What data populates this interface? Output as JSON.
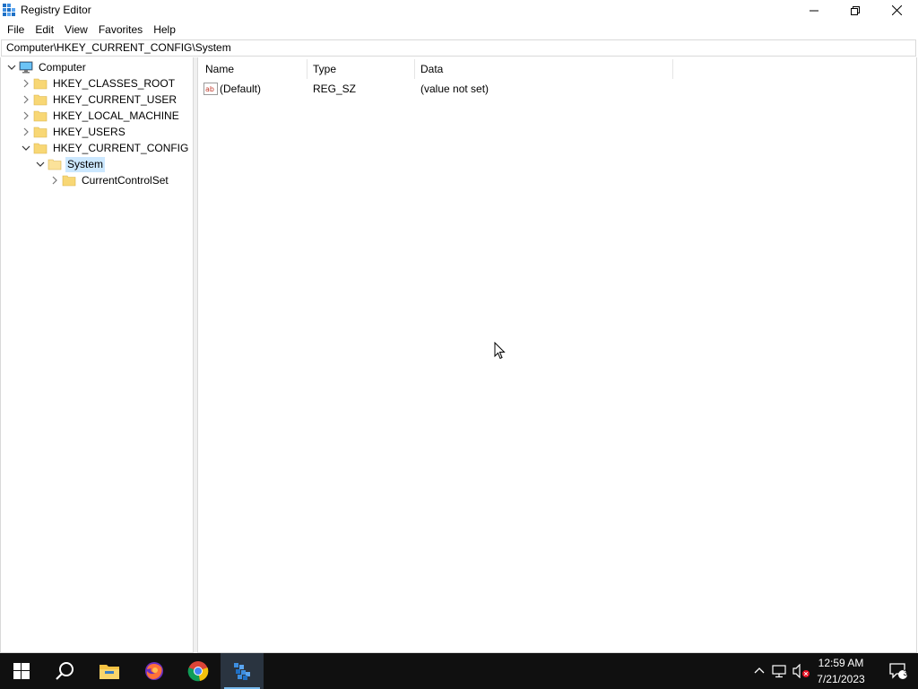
{
  "window": {
    "title": "Registry Editor",
    "icon": "registry-editor-icon",
    "controls": [
      "minimize-icon",
      "restore-icon",
      "close-icon"
    ]
  },
  "menu": {
    "items": [
      "File",
      "Edit",
      "View",
      "Favorites",
      "Help"
    ]
  },
  "address": {
    "value": "Computer\\HKEY_CURRENT_CONFIG\\System"
  },
  "tree": {
    "items": [
      {
        "label": "Computer",
        "expanded": true,
        "icon": "computer-icon"
      },
      {
        "label": "HKEY_CLASSES_ROOT",
        "expanded": false,
        "icon": "folder-icon"
      },
      {
        "label": "HKEY_CURRENT_USER",
        "expanded": false,
        "icon": "folder-icon"
      },
      {
        "label": "HKEY_LOCAL_MACHINE",
        "expanded": false,
        "icon": "folder-icon"
      },
      {
        "label": "HKEY_USERS",
        "expanded": false,
        "icon": "folder-icon"
      },
      {
        "label": "HKEY_CURRENT_CONFIG",
        "expanded": true,
        "icon": "folder-icon"
      },
      {
        "label": "System",
        "expanded": true,
        "selected": true,
        "icon": "folder-icon"
      },
      {
        "label": "CurrentControlSet",
        "expanded": false,
        "icon": "folder-icon"
      }
    ]
  },
  "list": {
    "columns": [
      "Name",
      "Type",
      "Data"
    ],
    "rows": [
      {
        "name": "(Default)",
        "type": "REG_SZ",
        "data": "(value not set)",
        "icon": "string-value-icon"
      }
    ]
  },
  "taskbar": {
    "apps": [
      "start-icon",
      "search-icon",
      "file-explorer-icon",
      "firefox-icon",
      "chrome-icon",
      "registry-editor-icon"
    ],
    "active_app": "registry-editor-icon",
    "tray": [
      "chevron-up-icon",
      "network-icon",
      "volume-muted-icon"
    ],
    "time": "12:59 AM",
    "date": "7/21/2023",
    "notification_count": "3"
  },
  "colors": {
    "selection": "#cce8ff",
    "taskbar": "#101010",
    "accent": "#76b9ed"
  }
}
